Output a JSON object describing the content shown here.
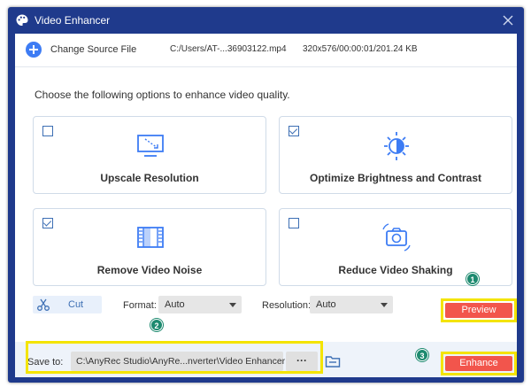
{
  "window": {
    "title": "Video Enhancer",
    "title_icon": "palette-icon",
    "close_icon": "close-icon"
  },
  "source": {
    "change_label": "Change Source File",
    "path": "C:/Users/AT-...36903122.mp4",
    "info": "320x576/00:00:01/201.24 KB"
  },
  "instruction": "Choose the following options to enhance video quality.",
  "options": [
    {
      "label": "Upscale Resolution",
      "checked": false,
      "icon": "upscale-icon"
    },
    {
      "label": "Optimize Brightness and Contrast",
      "checked": true,
      "icon": "brightness-icon"
    },
    {
      "label": "Remove Video Noise",
      "checked": true,
      "icon": "noise-icon"
    },
    {
      "label": "Reduce Video Shaking",
      "checked": false,
      "icon": "shake-camera-icon"
    }
  ],
  "controls": {
    "cut_label": "Cut",
    "format_label": "Format:",
    "format_value": "Auto",
    "resolution_label": "Resolution:",
    "resolution_value": "Auto",
    "preview_label": "Preview"
  },
  "footer": {
    "save_label": "Save to:",
    "save_path": "C:\\AnyRec Studio\\AnyRe...nverter\\Video Enhancer",
    "more_label": "···",
    "enhance_label": "Enhance"
  },
  "annotations": {
    "badge_1": "1",
    "badge_2": "2",
    "badge_3": "3"
  },
  "colors": {
    "frame": "#1f3a8c",
    "accent": "#3d7cf4",
    "button_red": "#f2554c",
    "highlight": "#f4e400",
    "badge": "#1d8a6f"
  }
}
